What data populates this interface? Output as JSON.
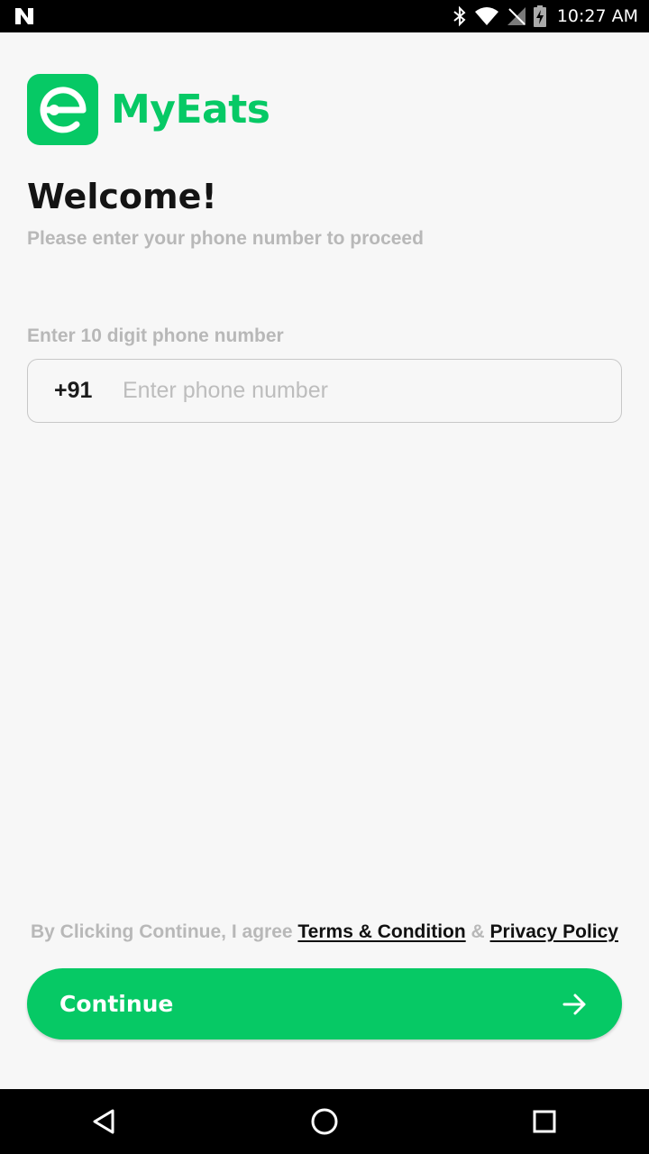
{
  "status_bar": {
    "time": "10:27 AM",
    "icons": [
      "notification-n-icon",
      "bluetooth-icon",
      "wifi-icon",
      "signal-off-icon",
      "battery-charging-icon"
    ]
  },
  "app": {
    "brand_name": "MyEats",
    "brand_color": "#06c965",
    "welcome_title": "Welcome!",
    "subtitle": "Please enter your phone number to proceed",
    "phone_label": "Enter 10 digit phone number",
    "country_code": "+91",
    "phone_placeholder": "Enter phone number",
    "phone_value": ""
  },
  "agreement": {
    "prefix": "By Clicking Continue, I agree",
    "terms_label": "Terms & Condition",
    "separator": "&",
    "privacy_label": "Privacy Policy"
  },
  "continue_button": {
    "label": "Continue",
    "icon": "arrow-right-icon"
  },
  "nav_bar": {
    "icons": [
      "back-icon",
      "home-icon",
      "recents-icon"
    ]
  }
}
